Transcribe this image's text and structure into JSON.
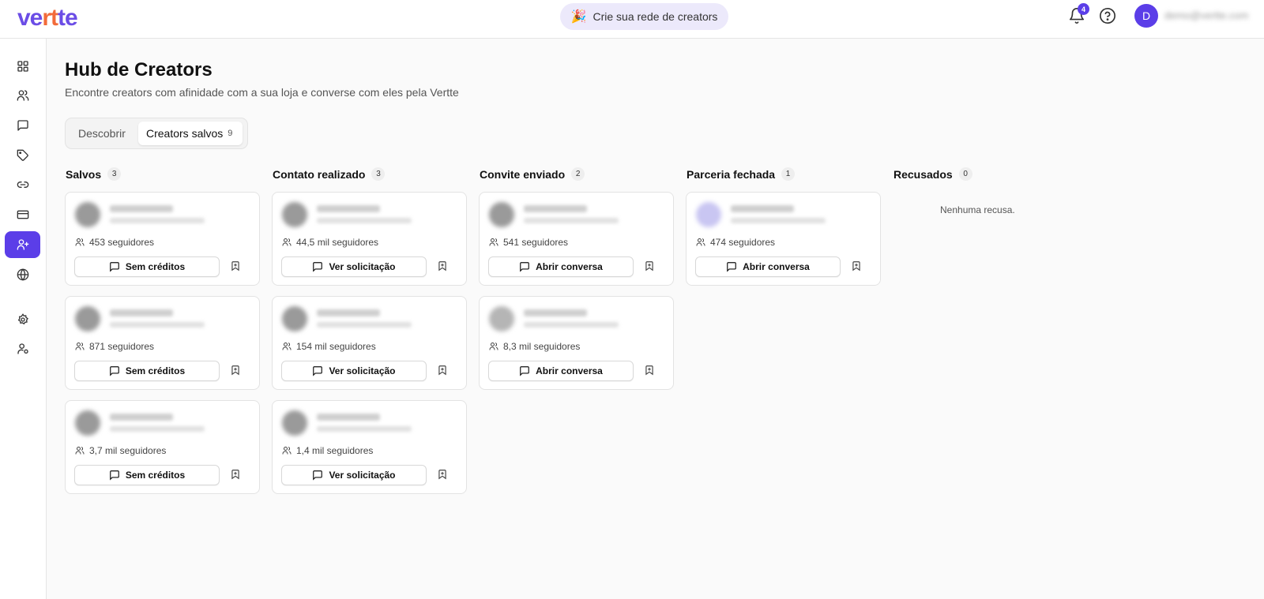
{
  "topbar": {
    "logo_left": "ve",
    "logo_accent": "rt",
    "logo_right": "te",
    "promo_emoji": "🎉",
    "promo_text": "Crie sua rede de creators",
    "notifications_count": "4",
    "avatar_initial": "D",
    "email": "demo@vertte.com"
  },
  "sidebar": {
    "items": [
      {
        "icon": "dashboard-icon"
      },
      {
        "icon": "users-icon"
      },
      {
        "icon": "chat-icon"
      },
      {
        "icon": "tag-icon"
      },
      {
        "icon": "link-icon"
      },
      {
        "icon": "card-icon"
      },
      {
        "icon": "add-user-icon",
        "active": true
      },
      {
        "icon": "globe-icon"
      },
      {
        "icon": "gear-icon"
      },
      {
        "icon": "user-settings-icon"
      }
    ]
  },
  "page": {
    "title": "Hub de Creators",
    "subtitle": "Encontre creators com afinidade com a sua loja e converse com eles pela Vertte"
  },
  "tabs": [
    {
      "label": "Descobrir"
    },
    {
      "label": "Creators salvos",
      "count": "9"
    }
  ],
  "columns": [
    {
      "title": "Salvos",
      "count": "3"
    },
    {
      "title": "Contato realizado",
      "count": "3"
    },
    {
      "title": "Convite enviado",
      "count": "2"
    },
    {
      "title": "Parceria fechada",
      "count": "1"
    },
    {
      "title": "Recusados",
      "count": "0",
      "empty_text": "Nenhuma recusa."
    }
  ],
  "cards": {
    "salvos": [
      {
        "followers": "453 seguidores",
        "action": "Sem créditos"
      },
      {
        "followers": "871 seguidores",
        "action": "Sem créditos"
      },
      {
        "followers": "3,7 mil seguidores",
        "action": "Sem créditos"
      }
    ],
    "contato": [
      {
        "followers": "44,5 mil seguidores",
        "action": "Ver solicitação"
      },
      {
        "followers": "154 mil seguidores",
        "action": "Ver solicitação"
      },
      {
        "followers": "1,4 mil seguidores",
        "action": "Ver solicitação"
      }
    ],
    "convite": [
      {
        "followers": "541 seguidores",
        "action": "Abrir conversa"
      },
      {
        "followers": "8,3 mil seguidores",
        "action": "Abrir conversa"
      }
    ],
    "parceria": [
      {
        "followers": "474 seguidores",
        "action": "Abrir conversa"
      }
    ]
  },
  "colors": {
    "accent": "#5b3ee8",
    "logo_orange": "#f26b3a"
  }
}
